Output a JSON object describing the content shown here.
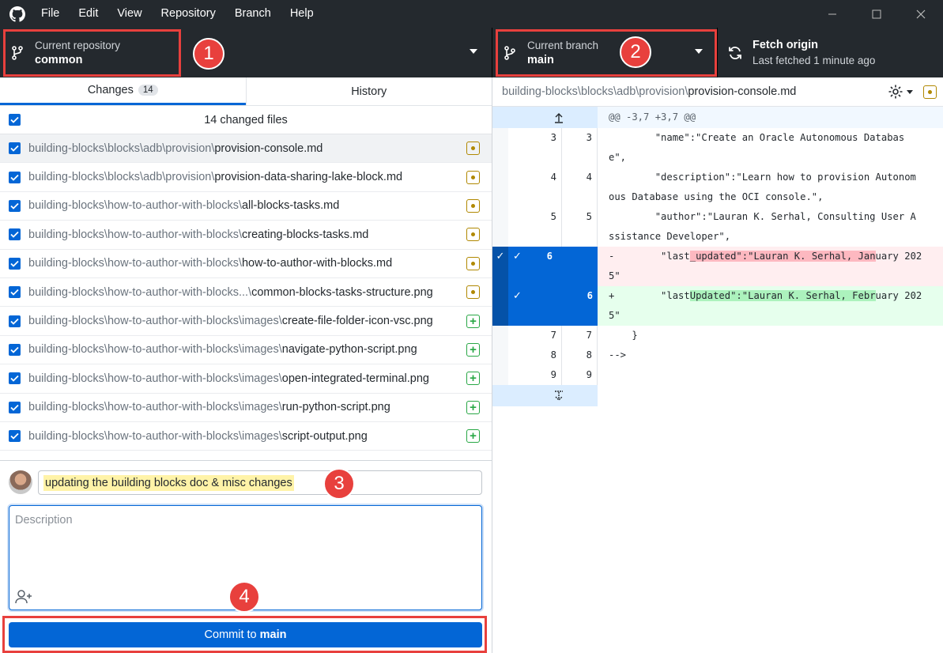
{
  "menu": [
    "File",
    "Edit",
    "View",
    "Repository",
    "Branch",
    "Help"
  ],
  "toolbar": {
    "repo_label": "Current repository",
    "repo_value": "common",
    "branch_label": "Current branch",
    "branch_value": "main",
    "fetch_label": "Fetch origin",
    "fetch_sub": "Last fetched 1 minute ago"
  },
  "callouts": [
    "1",
    "2",
    "3",
    "4"
  ],
  "tabs": {
    "changes": "Changes",
    "changes_count": "14",
    "history": "History"
  },
  "files_header": "14 changed files",
  "files": [
    {
      "dir": "building-blocks\\blocks\\adb\\provision\\",
      "name": "provision-console.md",
      "status": "modified"
    },
    {
      "dir": "building-blocks\\blocks\\adb\\provision\\",
      "name": "provision-data-sharing-lake-block.md",
      "status": "modified"
    },
    {
      "dir": "building-blocks\\how-to-author-with-blocks\\",
      "name": "all-blocks-tasks.md",
      "status": "modified"
    },
    {
      "dir": "building-blocks\\how-to-author-with-blocks\\",
      "name": "creating-blocks-tasks.md",
      "status": "modified"
    },
    {
      "dir": "building-blocks\\how-to-author-with-blocks\\",
      "name": "how-to-author-with-blocks.md",
      "status": "modified"
    },
    {
      "dir": "building-blocks\\how-to-author-with-blocks...\\",
      "name": "common-blocks-tasks-structure.png",
      "status": "modified"
    },
    {
      "dir": "building-blocks\\how-to-author-with-blocks\\images\\",
      "name": "create-file-folder-icon-vsc.png",
      "status": "added"
    },
    {
      "dir": "building-blocks\\how-to-author-with-blocks\\images\\",
      "name": "navigate-python-script.png",
      "status": "added"
    },
    {
      "dir": "building-blocks\\how-to-author-with-blocks\\images\\",
      "name": "open-integrated-terminal.png",
      "status": "added"
    },
    {
      "dir": "building-blocks\\how-to-author-with-blocks\\images\\",
      "name": "run-python-script.png",
      "status": "added"
    },
    {
      "dir": "building-blocks\\how-to-author-with-blocks\\images\\",
      "name": "script-output.png",
      "status": "added"
    }
  ],
  "commit": {
    "summary": "updating the building blocks doc & misc changes",
    "description_placeholder": "Description",
    "button_prefix": "Commit to",
    "button_branch": "main"
  },
  "diff": {
    "path_dir": "building-blocks\\blocks\\adb\\provision\\",
    "path_file": "provision-console.md",
    "hunk": "@@ -3,7 +3,7 @@",
    "lines": [
      {
        "type": "ctx",
        "old": "3",
        "new": "3",
        "text": "        \"name\":\"Create an Oracle Autonomous Databas\ne\","
      },
      {
        "type": "ctx",
        "old": "4",
        "new": "4",
        "text": "        \"description\":\"Learn how to provision Autonom\nous Database using the OCI console.\","
      },
      {
        "type": "ctx",
        "old": "5",
        "new": "5",
        "text": "        \"author\":\"Lauran K. Serhal, Consulting User A\nssistance Developer\","
      },
      {
        "type": "del",
        "old": "6",
        "new": "",
        "marker": "-",
        "pre": "        \"last",
        "hl": "_updated\":\"Lauran K. Serhal, Jan",
        "post": "uary 202\n5\""
      },
      {
        "type": "add",
        "old": "",
        "new": "6",
        "marker": "+",
        "pre": "        \"last",
        "hl": "Updated\":\"Lauran K. Serhal, Febr",
        "post": "uary 202\n5\""
      },
      {
        "type": "ctx",
        "old": "7",
        "new": "7",
        "text": "    }"
      },
      {
        "type": "ctx",
        "old": "8",
        "new": "8",
        "text": "-->"
      },
      {
        "type": "ctx",
        "old": "9",
        "new": "9",
        "text": ""
      }
    ]
  }
}
